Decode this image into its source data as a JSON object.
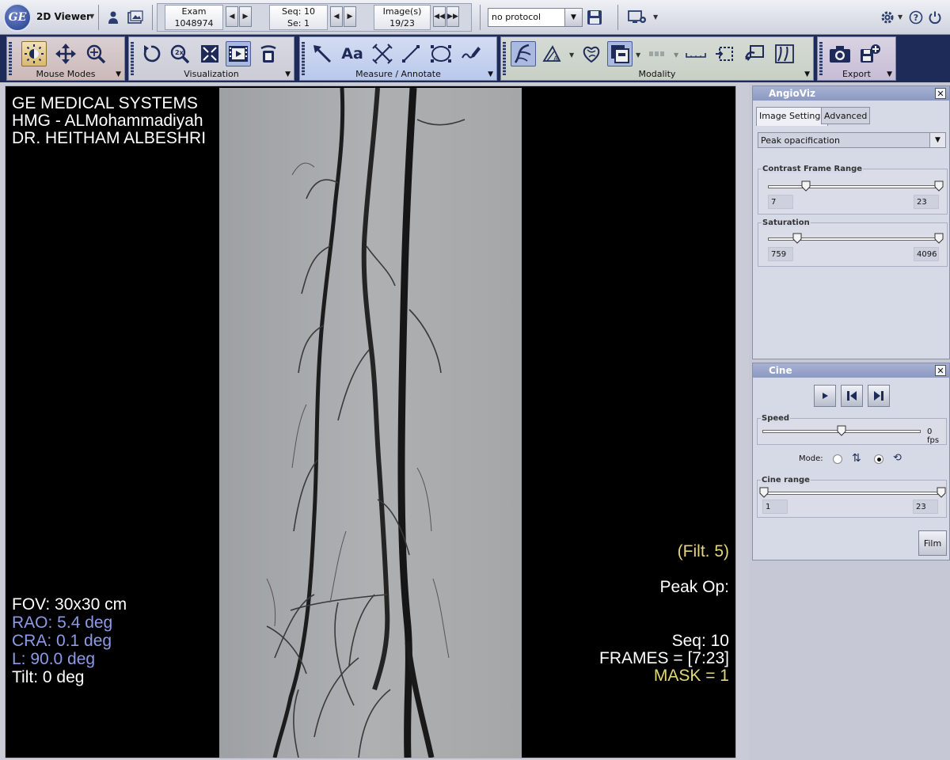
{
  "app": {
    "logo_text": "GE",
    "title": "2D Viewer"
  },
  "navigator": {
    "exam": {
      "label": "Exam",
      "value": "1048974"
    },
    "sequence": {
      "label": "Seq: 10",
      "value": "Se: 1"
    },
    "images": {
      "label": "Image(s)",
      "value": "19/23"
    }
  },
  "protocol": {
    "selected": "no protocol"
  },
  "toolbar": {
    "groups": [
      {
        "label": "Mouse Modes"
      },
      {
        "label": "Visualization"
      },
      {
        "label": "Measure / Annotate"
      },
      {
        "label": "Modality"
      },
      {
        "label": "Export"
      }
    ],
    "text_tool_label": "Aa",
    "zoom_2x_label": "2x"
  },
  "overlay": {
    "top_left": [
      "GE MEDICAL SYSTEMS",
      "HMG - ALMohammadiyah",
      "DR. HEITHAM ALBESHRI"
    ],
    "fov": "FOV: 30x30 cm",
    "rao": "RAO: 5.4 deg",
    "cra": "CRA: 0.1 deg",
    "l": "L: 90.0 deg",
    "tilt": "Tilt: 0 deg",
    "filter": "(Filt. 5)",
    "peak": "Peak Op:",
    "seq": "Seq: 10",
    "frames": "FRAMES = [7:23]",
    "mask": "MASK =  1"
  },
  "angioviz": {
    "title": "AngioViz",
    "tabs": [
      "Image Settings",
      "Advanced"
    ],
    "mode_select": "Peak opacification",
    "contrast_range": {
      "label": "Contrast Frame Range",
      "min": 7,
      "max": 23,
      "min_fraction": 0.22,
      "max_fraction": 1.0
    },
    "saturation": {
      "label": "Saturation",
      "min": 759,
      "max": 4096,
      "min_fraction": 0.17,
      "max_fraction": 1.0
    }
  },
  "cine": {
    "title": "Cine",
    "speed": {
      "label": "Speed",
      "value": "0 fps",
      "fraction": 0.5
    },
    "mode_label": "Mode:",
    "range": {
      "label": "Cine range",
      "min": 1,
      "max": 23
    },
    "film_label": "Film"
  },
  "colors": {
    "overlay_white": "#ffffff",
    "overlay_blue": "#8d9be6",
    "overlay_yellow": "#e3d77a",
    "toolbar_bg": "#1e2a58"
  }
}
